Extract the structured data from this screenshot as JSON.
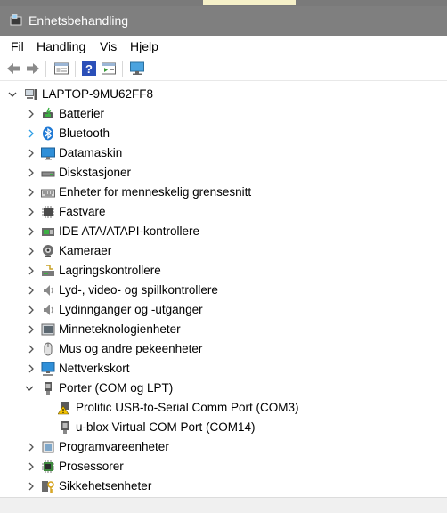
{
  "window": {
    "title": "Enhetsbehandling",
    "icon": "device-manager-icon"
  },
  "menu": [
    {
      "id": "fil",
      "label": "Fil"
    },
    {
      "id": "handling",
      "label": "Handling"
    },
    {
      "id": "vis",
      "label": "Vis"
    },
    {
      "id": "hjelp",
      "label": "Hjelp"
    }
  ],
  "toolbar": {
    "buttons": [
      {
        "name": "back-arrow-icon"
      },
      {
        "name": "forward-arrow-icon"
      },
      {
        "name": "properties-sheet-icon"
      },
      {
        "name": "help-icon"
      },
      {
        "name": "run-action-icon"
      },
      {
        "name": "monitor-scan-icon"
      }
    ]
  },
  "tree": {
    "root": {
      "label": "LAPTOP-9MU62FF8",
      "icon": "computer-icon",
      "expanded": true
    },
    "items": [
      {
        "label": "Batterier",
        "icon": "battery-icon"
      },
      {
        "label": "Bluetooth",
        "icon": "bluetooth-icon",
        "chevron_color": "#2e9fe6"
      },
      {
        "label": "Datamaskin",
        "icon": "monitor-icon"
      },
      {
        "label": "Diskstasjoner",
        "icon": "disk-drive-icon"
      },
      {
        "label": "Enheter for menneskelig grensesnitt",
        "icon": "keyboard-icon"
      },
      {
        "label": "Fastvare",
        "icon": "chip-icon"
      },
      {
        "label": "IDE ATA/ATAPI-kontrollere",
        "icon": "ide-controller-icon"
      },
      {
        "label": "Kameraer",
        "icon": "camera-icon"
      },
      {
        "label": "Lagringskontrollere",
        "icon": "storage-controller-icon"
      },
      {
        "label": "Lyd-, video- og spillkontrollere",
        "icon": "speaker-icon"
      },
      {
        "label": "Lydinnganger og -utganger",
        "icon": "speaker-icon"
      },
      {
        "label": "Minneteknologienheter",
        "icon": "memory-icon"
      },
      {
        "label": "Mus og andre pekeenheter",
        "icon": "mouse-icon"
      },
      {
        "label": "Nettverkskort",
        "icon": "network-adapter-icon"
      },
      {
        "label": "Porter (COM og LPT)",
        "icon": "port-icon",
        "expanded": true,
        "children": [
          {
            "label": "Prolific USB-to-Serial Comm Port (COM3)",
            "icon": "warning-port-icon"
          },
          {
            "label": "u-blox Virtual COM Port (COM14)",
            "icon": "port-icon"
          }
        ]
      },
      {
        "label": "Programvareenheter",
        "icon": "software-device-icon"
      },
      {
        "label": "Prosessorer",
        "icon": "processor-icon"
      },
      {
        "label": "Sikkehetsenheter",
        "icon": "security-key-icon"
      }
    ]
  }
}
